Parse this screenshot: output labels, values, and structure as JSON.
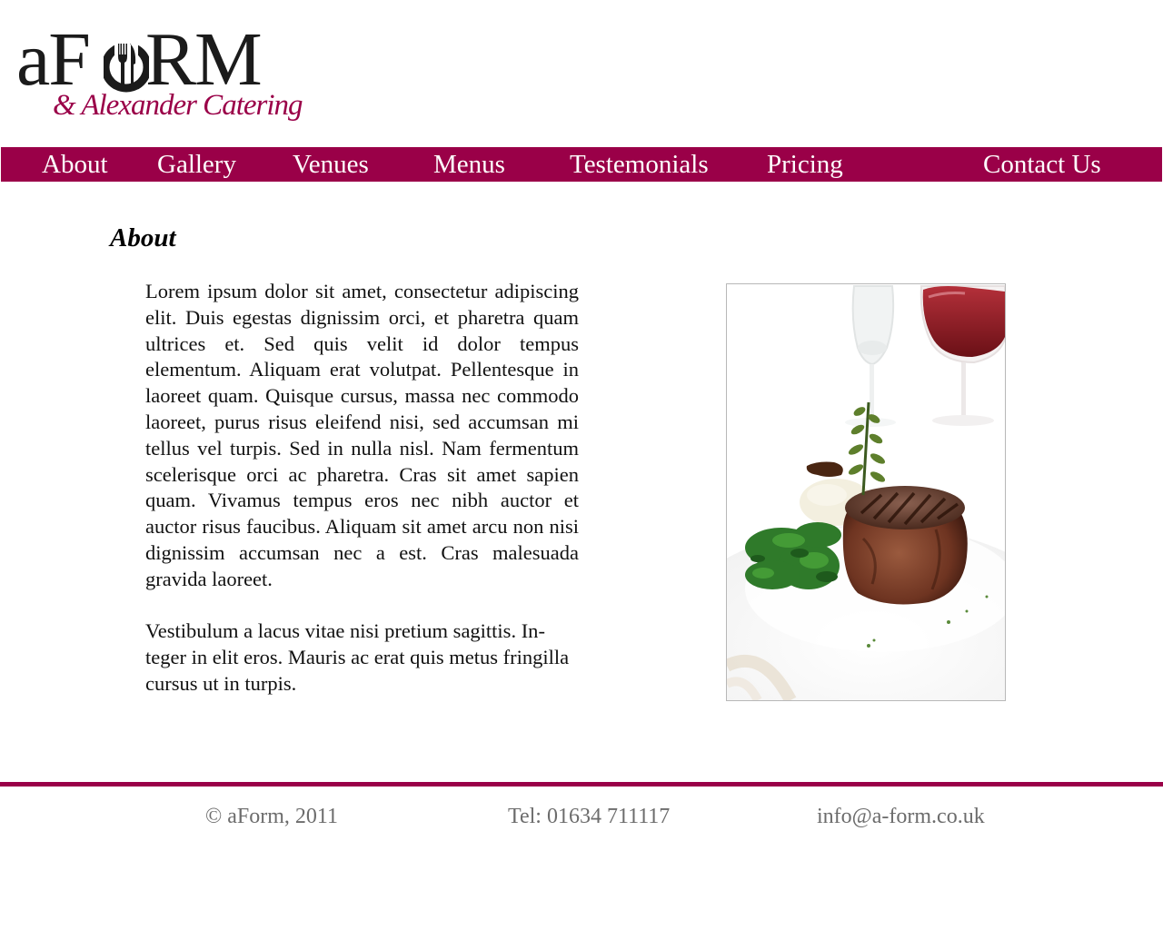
{
  "logo": {
    "main": "aFORM",
    "sub": "& Alexander Catering"
  },
  "nav": {
    "items": [
      {
        "label": "About"
      },
      {
        "label": "Gallery"
      },
      {
        "label": "Venues"
      },
      {
        "label": "Menus"
      },
      {
        "label": "Testemonials"
      },
      {
        "label": "Pricing"
      },
      {
        "label": "Contact Us"
      }
    ]
  },
  "content": {
    "title": "About",
    "paragraphs": [
      "Lorem ipsum dolor sit amet, consectetur adipiscing elit. Duis egestas dignissim orci, et pharetra quam ultrices et. Sed quis velit id dolor tempus elementum. Aliquam erat volutpat. Pellentesque in laoreet quam. Quisque cursus, massa nec commodo laoreet, purus risus eleifend nisi, sed accumsan mi tellus vel turpis. Sed in nulla nisl. Nam fermentum scelerisque orci ac pharetra. Cras sit amet sapien quam. Vivamus tempus eros nec nibh auctor et auctor risus faucibus. Aliquam sit amet arcu non nisi dignissim accumsan nec a est. Cras malesuada gravida laoreet.",
      "Vestibulum a lacus vitae nisi pretium sagittis. In­teger in elit eros. Mauris ac erat quis metus fring­illa cursus ut in turpis."
    ]
  },
  "footer": {
    "copyright": "© aForm, 2011",
    "phone": "Tel: 01634 711117",
    "email": "info@a-form.co.uk"
  },
  "colors": {
    "brand": "#9a0048",
    "footer_text": "#6c6c6c"
  },
  "icons": {
    "logo_mark": "fork-and-knife-icon"
  }
}
